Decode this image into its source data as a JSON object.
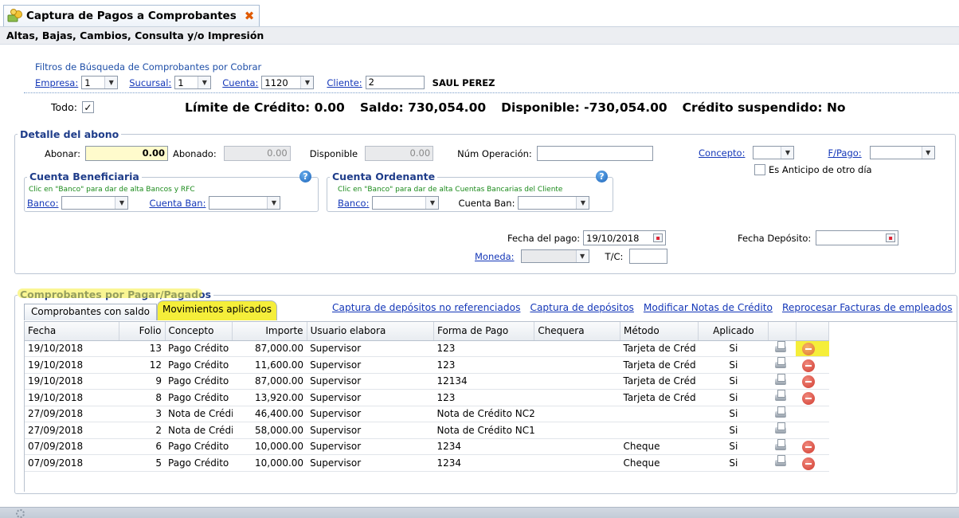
{
  "tab": {
    "title": "Captura de Pagos a Comprobantes",
    "close_glyph": "✖"
  },
  "subtitle": "Altas, Bajas, Cambios, Consulta y/o Impresión",
  "filters": {
    "title": "Filtros de Búsqueda de Comprobantes por Cobrar",
    "empresa_label": "Empresa:",
    "empresa_value": "1",
    "sucursal_label": "Sucursal:",
    "sucursal_value": "1",
    "cuenta_label": "Cuenta:",
    "cuenta_value": "1120",
    "cliente_label": "Cliente:",
    "cliente_value": "2",
    "cliente_name": "SAUL PEREZ"
  },
  "summary": {
    "todo_label": "Todo:",
    "todo_checked": "✓",
    "limite": "Límite de Crédito: 0.00",
    "saldo": "Saldo: 730,054.00",
    "disponible": "Disponible: -730,054.00",
    "suspendido": "Crédito suspendido: No"
  },
  "abono": {
    "legend": "Detalle del abono",
    "abonar_label": "Abonar:",
    "abonar_value": "0.00",
    "abonado_label": "Abonado:",
    "abonado_value": "0.00",
    "disponible_label": "Disponible",
    "disponible_value": "0.00",
    "num_operacion_label": "Núm Operación:",
    "concepto_label": "Concepto:",
    "fpago_label": "F/Pago:",
    "anticipo_label": "Es Anticipo de otro día",
    "fecha_pago_label": "Fecha del pago:",
    "fecha_pago_value": "19/10/2018",
    "fecha_deposito_label": "Fecha Depósito:",
    "moneda_label": "Moneda:",
    "tc_label": "T/C:"
  },
  "beneficiaria": {
    "legend": "Cuenta Beneficiaria",
    "hint": "Clic en \"Banco\" para dar de alta Bancos y RFC",
    "banco_label": "Banco:",
    "cuenta_label": "Cuenta Ban:"
  },
  "ordenante": {
    "legend": "Cuenta Ordenante",
    "hint": "Clic en \"Banco\" para dar de alta Cuentas Bancarias del Cliente",
    "banco_label": "Banco:",
    "cuenta_label": "Cuenta Ban:"
  },
  "comprobantes": {
    "legend": "Comprobantes por Pagar/Pagados",
    "tabs": [
      "Comprobantes con saldo",
      "Movimientos aplicados"
    ],
    "links": [
      "Captura de depósitos no referenciados",
      "Captura de depósitos",
      "Modificar Notas de Crédito",
      "Reprocesar Facturas de empleados"
    ],
    "columns": [
      "Fecha",
      "Folio",
      "Concepto",
      "Importe",
      "Usuario elabora",
      "Forma de Pago",
      "Chequera",
      "Método",
      "Aplicado",
      "",
      ""
    ],
    "rows": [
      {
        "fecha": "19/10/2018",
        "folio": "13",
        "concepto": "Pago Crédito",
        "importe": "87,000.00",
        "usuario": "Supervisor",
        "forma": "123",
        "chequera": "",
        "metodo": "Tarjeta de Créd",
        "aplicado": "Si",
        "del": true
      },
      {
        "fecha": "19/10/2018",
        "folio": "12",
        "concepto": "Pago Crédito",
        "importe": "11,600.00",
        "usuario": "Supervisor",
        "forma": "123",
        "chequera": "",
        "metodo": "Tarjeta de Créd",
        "aplicado": "Si",
        "del": true
      },
      {
        "fecha": "19/10/2018",
        "folio": "9",
        "concepto": "Pago Crédito",
        "importe": "87,000.00",
        "usuario": "Supervisor",
        "forma": "12134",
        "chequera": "",
        "metodo": "Tarjeta de Créd",
        "aplicado": "Si",
        "del": true
      },
      {
        "fecha": "19/10/2018",
        "folio": "8",
        "concepto": "Pago Crédito",
        "importe": "13,920.00",
        "usuario": "Supervisor",
        "forma": "123",
        "chequera": "",
        "metodo": "Tarjeta de Créd",
        "aplicado": "Si",
        "del": true
      },
      {
        "fecha": "27/09/2018",
        "folio": "3",
        "concepto": "Nota de Crédi",
        "importe": "46,400.00",
        "usuario": "Supervisor",
        "forma": "Nota de Crédito NC2",
        "chequera": "",
        "metodo": "",
        "aplicado": "Si",
        "del": false
      },
      {
        "fecha": "27/09/2018",
        "folio": "2",
        "concepto": "Nota de Crédi",
        "importe": "58,000.00",
        "usuario": "Supervisor",
        "forma": "Nota de Crédito NC1",
        "chequera": "",
        "metodo": "",
        "aplicado": "Si",
        "del": false
      },
      {
        "fecha": "07/09/2018",
        "folio": "6",
        "concepto": "Pago Crédito",
        "importe": "10,000.00",
        "usuario": "Supervisor",
        "forma": "1234",
        "chequera": "",
        "metodo": "Cheque",
        "aplicado": "Si",
        "del": true
      },
      {
        "fecha": "07/09/2018",
        "folio": "5",
        "concepto": "Pago Crédito",
        "importe": "10,000.00",
        "usuario": "Supervisor",
        "forma": "1234",
        "chequera": "",
        "metodo": "Cheque",
        "aplicado": "Si",
        "del": true
      }
    ]
  },
  "icons": {
    "tab": "money-coins-icon",
    "help": "question-icon",
    "print": "printer-icon",
    "delete": "delete-icon",
    "status": "gear-icon"
  },
  "colors": {
    "highlight": "#f5ee3a",
    "link": "#1437b8",
    "legend": "#1f3d8a",
    "delete": "#d03a2e"
  }
}
